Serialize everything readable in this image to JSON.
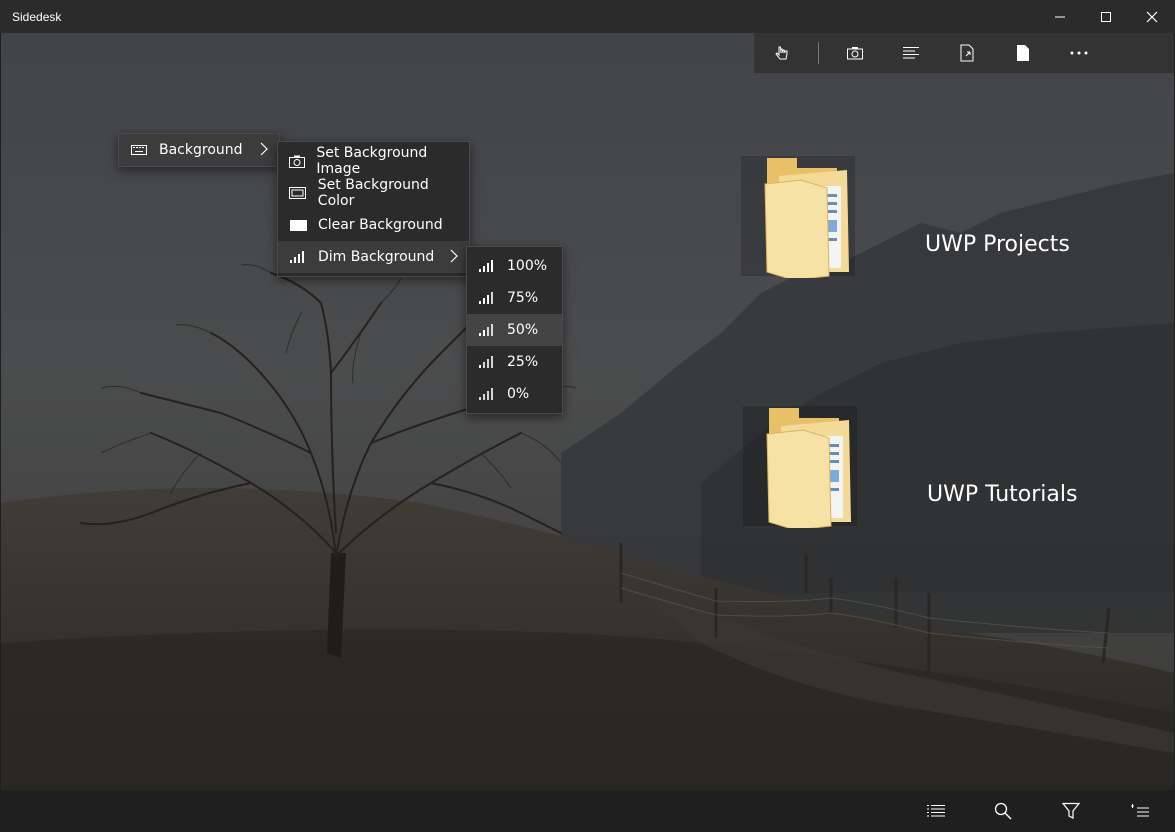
{
  "window": {
    "title": "Sidedesk"
  },
  "folders": [
    {
      "label": "UWP Projects"
    },
    {
      "label": "UWP Tutorials"
    }
  ],
  "context_menu": {
    "root": {
      "label": "Background",
      "icon": "keyboard-icon"
    },
    "submenu": [
      {
        "label": "Set Background Image",
        "icon": "camera-icon"
      },
      {
        "label": "Set Background Color",
        "icon": "color-swatch-icon"
      },
      {
        "label": "Clear Background",
        "icon": "blank-rectangle-icon"
      },
      {
        "label": "Dim Background",
        "icon": "signal-bars-icon"
      }
    ],
    "dim_options": [
      {
        "label": "100%",
        "level": 1.0
      },
      {
        "label": "75%",
        "level": 0.75
      },
      {
        "label": "50%",
        "level": 0.5,
        "highlighted": true
      },
      {
        "label": "25%",
        "level": 0.25
      },
      {
        "label": "0%",
        "level": 0.0
      }
    ]
  },
  "toolbar": {
    "buttons": [
      "touch-select-icon",
      "camera-icon",
      "align-text-icon",
      "export-file-icon",
      "page-icon",
      "more-icon"
    ]
  },
  "bottom_bar": {
    "buttons": [
      "list-view-icon",
      "search-icon",
      "filter-icon",
      "sort-icon"
    ]
  },
  "colors": {
    "menu_bg": "#2b2b2b",
    "titlebar_bg": "#2b2b2b",
    "folder_yellow": "#f5d67f"
  }
}
